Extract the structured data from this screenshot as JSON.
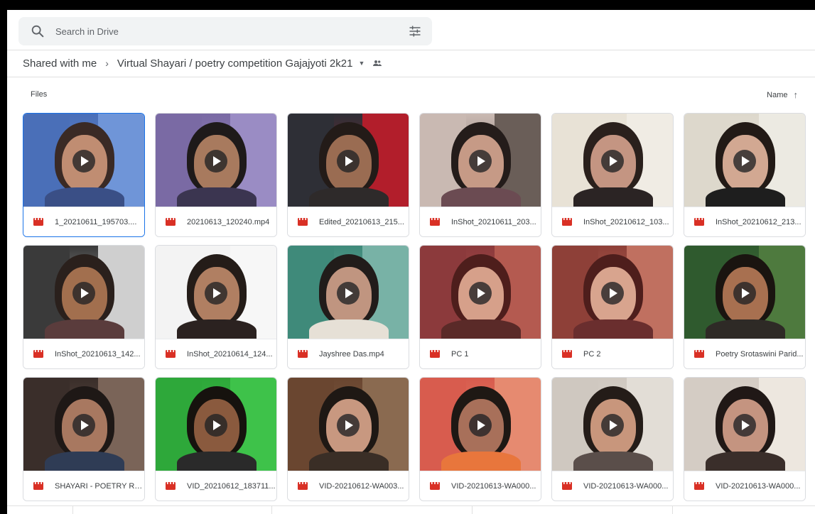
{
  "search": {
    "placeholder": "Search in Drive"
  },
  "breadcrumb": {
    "root": "Shared with me",
    "folder": "Virtual Shayari / poetry competition Gajajyoti 2k21"
  },
  "section_label": "Files",
  "sort": {
    "label": "Name",
    "direction": "ascending"
  },
  "accent_color": "#1a73e8",
  "video_icon_color": "#d93025",
  "files": [
    {
      "name": "1_20210611_195703....",
      "selected": true
    },
    {
      "name": "20210613_120240.mp4"
    },
    {
      "name": "Edited_20210613_215..."
    },
    {
      "name": "InShot_20210611_203..."
    },
    {
      "name": "InShot_20210612_103..."
    },
    {
      "name": "InShot_20210612_213..."
    },
    {
      "name": "InShot_20210613_142..."
    },
    {
      "name": "InShot_20210614_124..."
    },
    {
      "name": "Jayshree Das.mp4"
    },
    {
      "name": "PC 1"
    },
    {
      "name": "PC 2"
    },
    {
      "name": "Poetry Srotaswini Parid..."
    },
    {
      "name": "SHAYARI - POETRY Rec..."
    },
    {
      "name": "VID_20210612_183711..."
    },
    {
      "name": "VID-20210612-WA003..."
    },
    {
      "name": "VID-20210613-WA000..."
    },
    {
      "name": "VID-20210613-WA000..."
    },
    {
      "name": "VID-20210613-WA000..."
    }
  ]
}
